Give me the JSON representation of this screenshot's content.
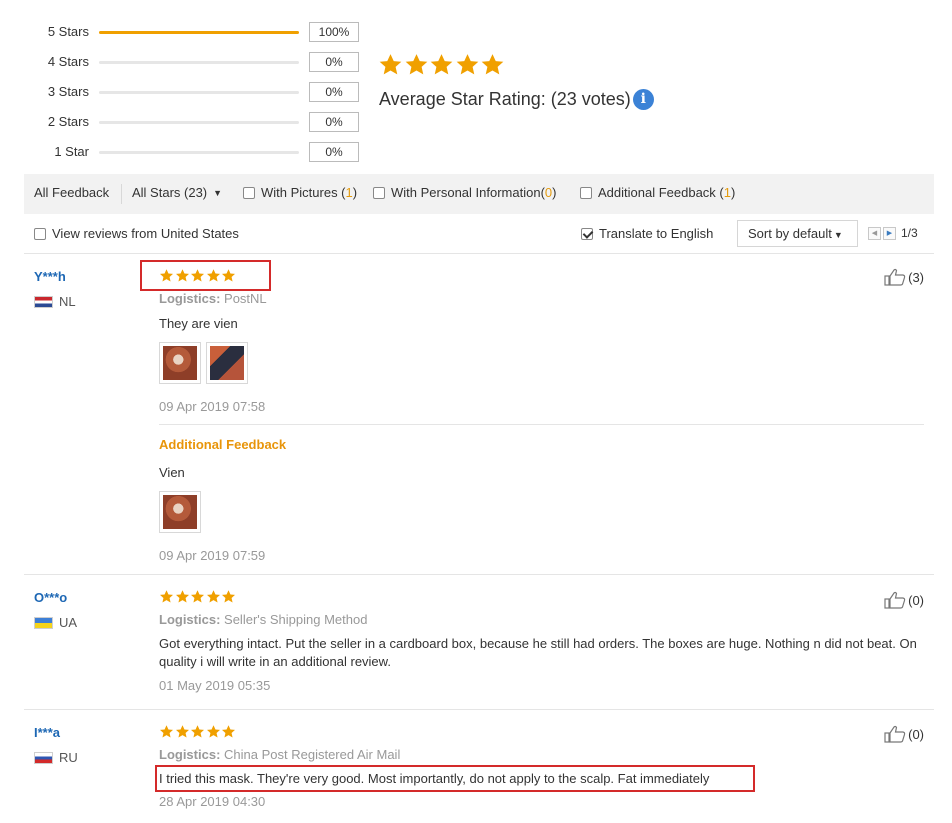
{
  "rating_summary": {
    "rows": [
      {
        "label": "5 Stars",
        "percent_text": "100%",
        "fill_fraction": 1.0
      },
      {
        "label": "4 Stars",
        "percent_text": "0%",
        "fill_fraction": 0
      },
      {
        "label": "3 Stars",
        "percent_text": "0%",
        "fill_fraction": 0
      },
      {
        "label": "2 Stars",
        "percent_text": "0%",
        "fill_fraction": 0
      },
      {
        "label": "1 Star",
        "percent_text": "0%",
        "fill_fraction": 0
      }
    ],
    "average_stars": 5,
    "average_label": "Average Star Rating:  (23 votes)",
    "info_glyph": "i"
  },
  "filters": {
    "all_feedback": "All Feedback",
    "all_stars": "All Stars (23)",
    "with_pictures_label": "With Pictures (",
    "with_pictures_count": "1",
    "with_personal_label": "With Personal Information(",
    "with_personal_count": "0",
    "additional_label": "Additional Feedback (",
    "additional_count": "1",
    "close_paren": ")"
  },
  "options": {
    "local_reviews": "View reviews from United States",
    "translate": "Translate to English",
    "sort": "Sort by default",
    "page_indicator": "1/3"
  },
  "reviews": [
    {
      "name": "Y***h",
      "country": "NL",
      "stars": 5,
      "logistics_label": "Logistics:",
      "logistics_value": "PostNL",
      "text": "They are vien",
      "date": "09 Apr 2019 07:58",
      "helpful": "(3)",
      "additional": {
        "title": "Additional Feedback",
        "text": "Vien",
        "date": "09 Apr 2019 07:59"
      }
    },
    {
      "name": "O***o",
      "country": "UA",
      "stars": 5,
      "logistics_label": "Logistics:",
      "logistics_value": "Seller's Shipping Method",
      "text": "Got everything intact. Put the seller in a cardboard box, because he still had orders. The boxes are huge. Nothing n did not beat. On quality i will write in an additional review.",
      "date": "01 May 2019 05:35",
      "helpful": "(0)"
    },
    {
      "name": "I***a",
      "country": "RU",
      "stars": 5,
      "logistics_label": "Logistics:",
      "logistics_value": "China Post Registered Air Mail",
      "text": "I tried this mask. They're very good. Most importantly, do not apply to the scalp. Fat immediately",
      "date": "28 Apr 2019 04:30",
      "helpful": "(0)"
    }
  ],
  "colors": {
    "star": "#f0a000",
    "accent_orange": "#e8950a",
    "link_blue": "#1d67b4",
    "highlight_red": "#d42a2a"
  }
}
